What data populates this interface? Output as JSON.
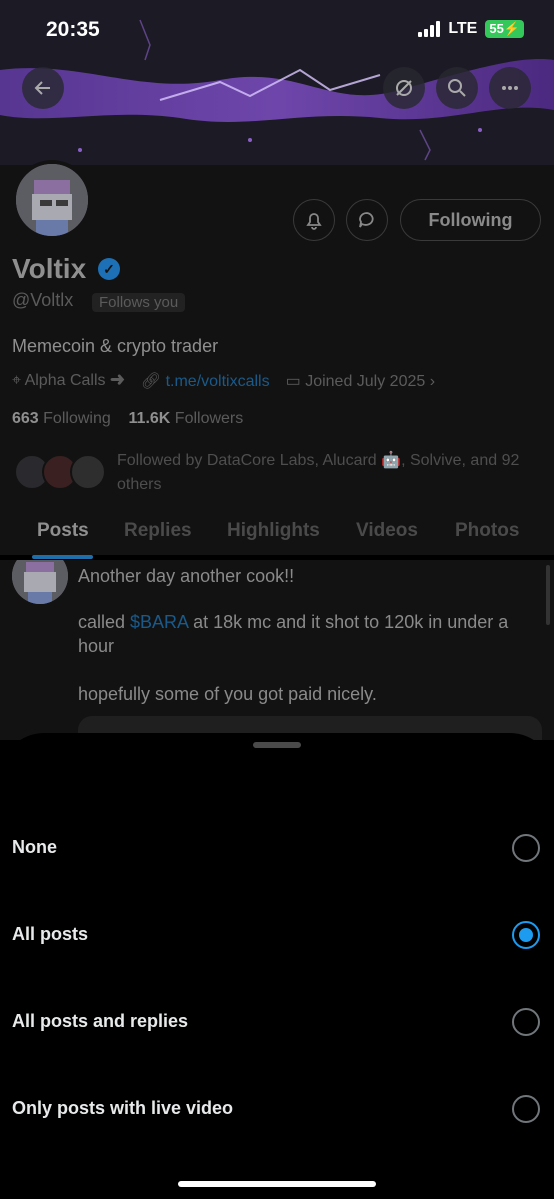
{
  "status": {
    "time": "20:35",
    "network": "LTE",
    "battery": "55"
  },
  "header": {
    "back_icon": "arrow-left-icon",
    "icons": [
      "no-notify-icon",
      "search-icon",
      "more-icon"
    ]
  },
  "profile": {
    "name": "Voltix",
    "handle": "@Voltlx",
    "follows_you": "Follows you",
    "following_button": "Following",
    "bio": "Memecoin & crypto trader",
    "category": "Alpha Calls",
    "link": "t.me/voltixcalls",
    "joined": "Joined July 2025",
    "following_count": "663",
    "following_label": "Following",
    "followers_count": "11.6K",
    "followers_label": "Followers",
    "followed_by": "Followed by DataCore Labs, Alucard 🤖, Solvive, and 92 others"
  },
  "tabs": [
    "Posts",
    "Replies",
    "Highlights",
    "Videos",
    "Photos"
  ],
  "post": {
    "line1": "Another day another cook!!",
    "line2_pre": "called ",
    "line2_cashtag": "$BARA",
    "line2_post": " at 18k mc and it shot to 120k in under a hour",
    "line3": "hopefully some of you got paid nicely."
  },
  "sheet": {
    "options": [
      {
        "label": "None",
        "selected": false
      },
      {
        "label": "All posts",
        "selected": true
      },
      {
        "label": "All posts and replies",
        "selected": false
      },
      {
        "label": "Only posts with live video",
        "selected": false
      }
    ]
  },
  "colors": {
    "accent": "#1d9bf0",
    "background": "#000000"
  }
}
